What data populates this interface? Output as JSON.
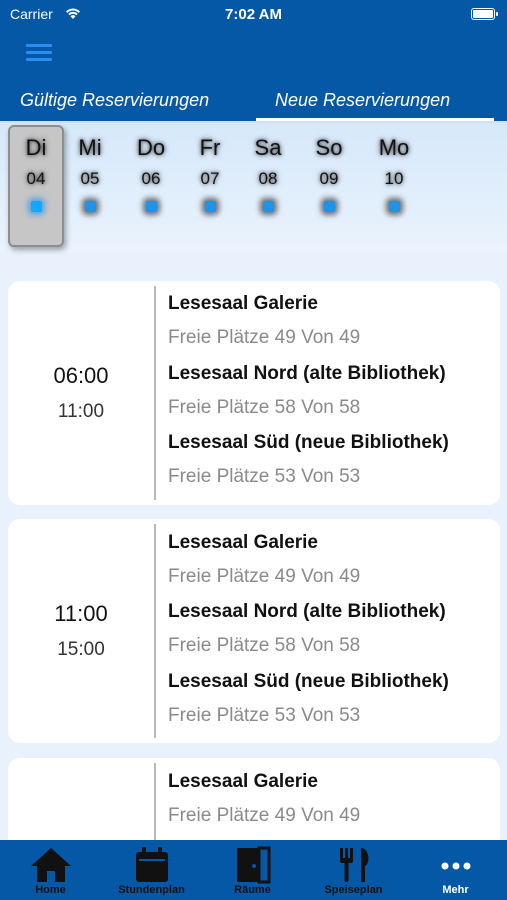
{
  "status_bar": {
    "carrier": "Carrier",
    "time": "7:02 AM"
  },
  "tabs": [
    {
      "label": "Gültige Reservierungen",
      "active": false
    },
    {
      "label": "Neue Reservierungen",
      "active": true
    }
  ],
  "days": [
    {
      "name": "Di",
      "num": "04",
      "selected": true
    },
    {
      "name": "Mi",
      "num": "05"
    },
    {
      "name": "Do",
      "num": "06"
    },
    {
      "name": "Fr",
      "num": "07"
    },
    {
      "name": "Sa",
      "num": "08"
    },
    {
      "name": "So",
      "num": "09"
    },
    {
      "name": "Mo",
      "num": "10"
    }
  ],
  "slots": [
    {
      "start": "06:00",
      "end": "11:00",
      "rooms": [
        {
          "name": "Lesesaal Galerie",
          "free": "Freie Plätze 49 Von 49"
        },
        {
          "name": "Lesesaal Nord (alte Bibliothek)",
          "free": "Freie Plätze 58 Von 58"
        },
        {
          "name": "Lesesaal Süd (neue Bibliothek)",
          "free": "Freie Plätze 53 Von 53"
        }
      ]
    },
    {
      "start": "11:00",
      "end": "15:00",
      "rooms": [
        {
          "name": "Lesesaal Galerie",
          "free": "Freie Plätze 49 Von 49"
        },
        {
          "name": "Lesesaal Nord (alte Bibliothek)",
          "free": "Freie Plätze 58 Von 58"
        },
        {
          "name": "Lesesaal Süd (neue Bibliothek)",
          "free": "Freie Plätze 53 Von 53"
        }
      ]
    },
    {
      "rooms": [
        {
          "name": "Lesesaal Galerie",
          "free": "Freie Plätze 49 Von 49"
        }
      ]
    }
  ],
  "tabbar": {
    "items": [
      {
        "label": "Home",
        "icon": "home-icon"
      },
      {
        "label": "Stundenplan",
        "icon": "calendar-icon"
      },
      {
        "label": "Räume",
        "icon": "door-icon"
      },
      {
        "label": "Speiseplan",
        "icon": "cutlery-icon"
      },
      {
        "label": "Mehr",
        "icon": "more-icon",
        "active": true
      }
    ]
  },
  "colors": {
    "brand": "#0558a6",
    "accent": "#2193e6",
    "background": "#e9f2fc"
  }
}
